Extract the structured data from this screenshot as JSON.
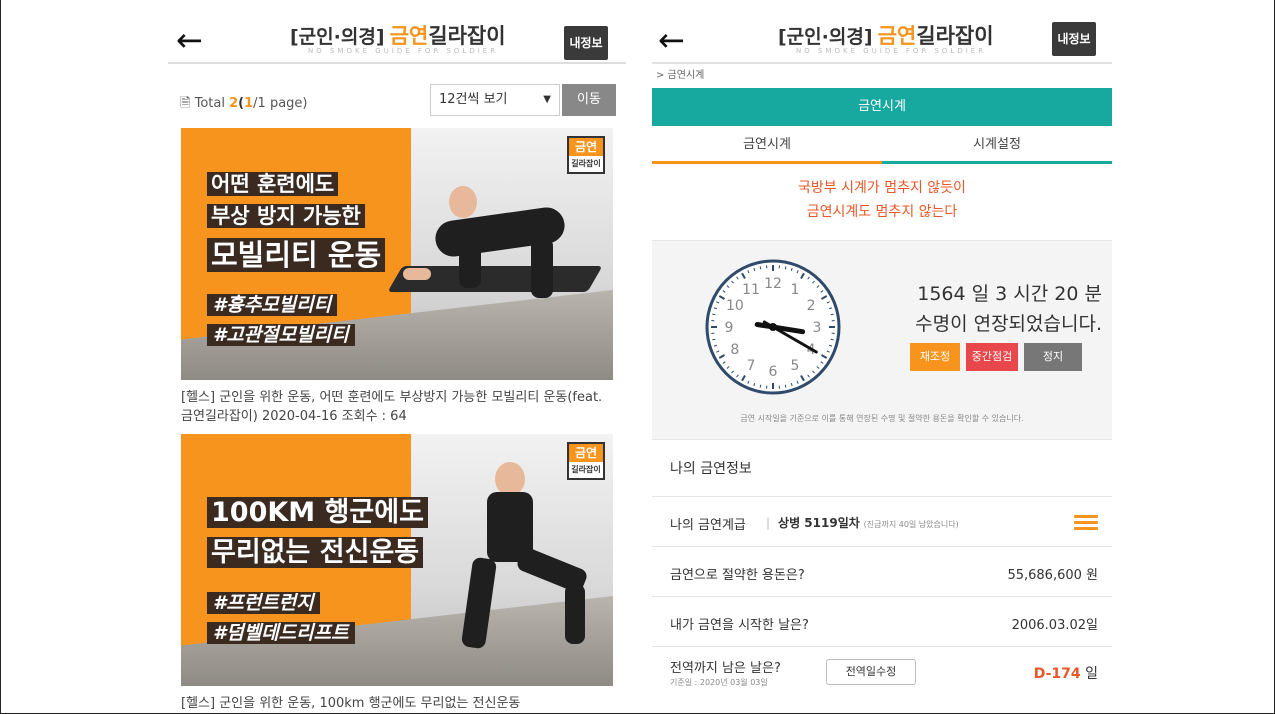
{
  "left": {
    "header": {
      "back": "←",
      "logo_prefix": "[군인·의경]",
      "logo_accent": "금연",
      "logo_main": "길라잡이",
      "logo_sub": "NO SMOKE GUIDE FOR SOLDIER",
      "my_info": "내정보"
    },
    "toolbar": {
      "total_label": "Total",
      "total_count": "2",
      "page_current": "1",
      "page_rest": "/1 page)",
      "page_open": "(",
      "per_page": "12건씩 보기",
      "go_button": "이동"
    },
    "cards": [
      {
        "badge_top": "금연",
        "badge_bottom": "길라잡이",
        "lines": [
          "어떤 훈련에도",
          "부상 방지 가능한",
          "모빌리티 운동"
        ],
        "tags": [
          "#흉추모빌리티",
          "#고관절모빌리티"
        ],
        "text": "[헬스] 군인을 위한 운동, 어떤 훈련에도 부상방지 가능한 모빌리티 운동(feat.금연길라잡이) 2020-04-16 조회수 : 64"
      },
      {
        "badge_top": "금연",
        "badge_bottom": "길라잡이",
        "lines": [
          "100KM 행군에도",
          "무리없는 전신운동"
        ],
        "tags": [
          "#프런트런지",
          "#덤벨데드리프트"
        ],
        "text": "[헬스] 군인을 위한 운동, 100km 행군에도 무리없는 전신운동"
      }
    ]
  },
  "right": {
    "header": {
      "back": "←",
      "logo_prefix": "[군인·의경]",
      "logo_accent": "금연",
      "logo_main": "길라잡이",
      "logo_sub": "NO SMOKE GUIDE FOR SOLDIER",
      "my_info": "내정보"
    },
    "breadcrumb": "> 금연시계",
    "section_title": "금연시계",
    "tabs": [
      "금연시계",
      "시계설정"
    ],
    "slogan": [
      "국방부 시계가 멈추지 않듯이",
      "금연시계도 멈추지 않는다"
    ],
    "clock_numbers": [
      "12",
      "1",
      "2",
      "3",
      "4",
      "5",
      "6",
      "7",
      "8",
      "9",
      "10",
      "11"
    ],
    "extended_line1": "1564 일 3 시간 20 분",
    "extended_line2": "수명이 연장되었습니다.",
    "buttons": [
      "재조정",
      "중간점검",
      "정지"
    ],
    "note": "금연 시작일을 기준으로 이를 통해 연장된 수명 및 절약한 용돈을 확인할 수 있습니다.",
    "info_title": "나의 금연정보",
    "rank_label": "나의 금연계급",
    "rank_value": "상병 5119일차",
    "rank_note": "(진급까지 40일 남았습니다)",
    "saved_label": "금연으로 절약한 용돈은?",
    "saved_value": "55,686,600 원",
    "start_label": "내가 금연을 시작한 날은?",
    "start_value": "2006.03.02일",
    "discharge_label": "전역까지 남은 날은?",
    "discharge_sub": "기준일 : 2020년 03월 03일",
    "discharge_edit": "전역일수정",
    "dday_value": "D-174",
    "dday_unit": "일"
  },
  "colors": {
    "accent": "#f7941d",
    "teal": "#17a8a0",
    "red": "#e8484c",
    "slogan": "#e8572a"
  },
  "clock": {
    "hour": 3.3,
    "minute": 20
  }
}
